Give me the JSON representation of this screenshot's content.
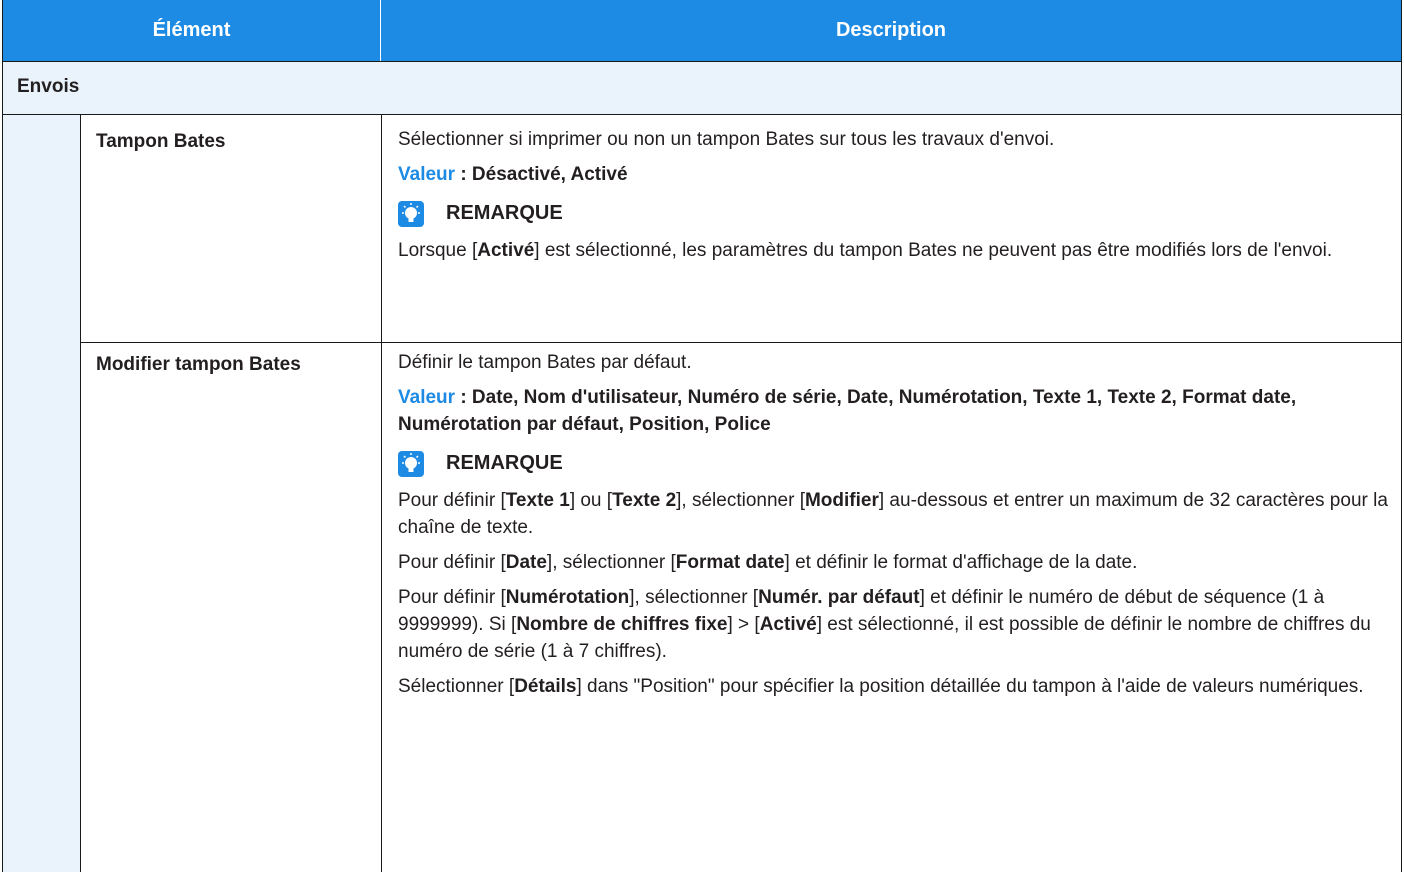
{
  "header": {
    "col1": "Élément",
    "col2": "Description"
  },
  "section": {
    "title": "Envois"
  },
  "rows": [
    {
      "item": "Tampon Bates",
      "desc": "Sélectionner si imprimer ou non un tampon Bates sur tous les travaux d'envoi.",
      "value_label": "Valeur",
      "value_text": " : Désactivé, Activé",
      "note_title": "REMARQUE",
      "note": {
        "t1": "Lorsque [",
        "b1": "Activé",
        "t2": "] est sélectionné, les paramètres du tampon Bates ne peuvent pas être modifiés lors de l'envoi."
      }
    },
    {
      "item": "Modifier tampon Bates",
      "desc": "Définir le tampon Bates par défaut.",
      "value_label": "Valeur",
      "value_text": " : Date, Nom d'utilisateur, Numéro de série, Date, Numérotation, Texte 1, Texte 2, Format date, Numérotation par défaut, Position, Police",
      "note_title": "REMARQUE",
      "p1": {
        "t1": "Pour définir [",
        "b1": "Texte 1",
        "t2": "] ou [",
        "b2": "Texte 2",
        "t3": "], sélectionner [",
        "b3": "Modifier",
        "t4": "] au-dessous et entrer un maximum de 32 caractères pour la chaîne de texte."
      },
      "p2": {
        "t1": "Pour définir [",
        "b1": "Date",
        "t2": "], sélectionner [",
        "b2": "Format date",
        "t3": "] et définir le format d'affichage de la date."
      },
      "p3": {
        "t1": "Pour définir [",
        "b1": "Numérotation",
        "t2": "], sélectionner [",
        "b2": "Numér. par défaut",
        "t3": "] et définir le numéro de début de séquence (1 à 9999999). Si [",
        "b3": "Nombre de chiffres fixe",
        "t4": "] > [",
        "b4": "Activé",
        "t5": "] est sélectionné, il est possible de définir le nombre de chiffres du numéro de série (1 à 7 chiffres)."
      },
      "p4": {
        "t1": "Sélectionner [",
        "b1": "Détails",
        "t2": "] dans \"Position\" pour spécifier la position détaillée du tampon à l'aide de valeurs numériques."
      }
    }
  ]
}
